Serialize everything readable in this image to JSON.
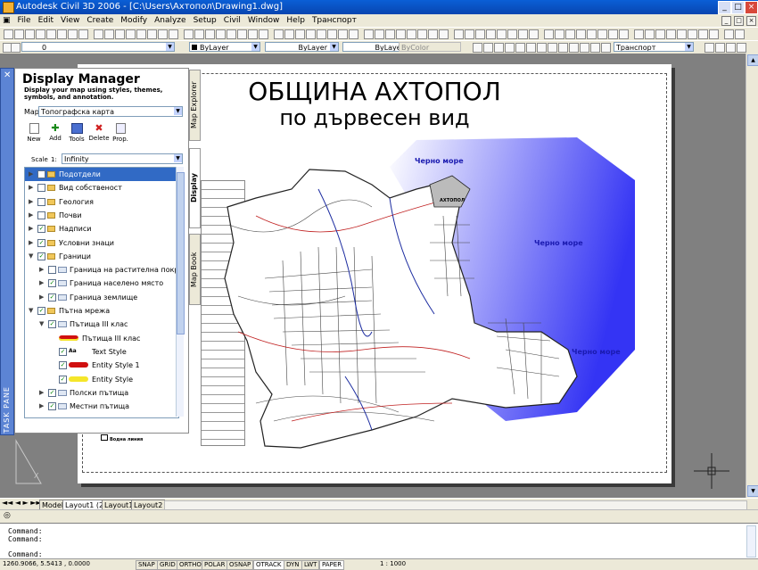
{
  "window": {
    "title": "Autodesk Civil 3D 2006 - [C:\\Users\\Ахтопол\\Drawing1.dwg]",
    "controls": [
      "_",
      "□",
      "×"
    ]
  },
  "menu": [
    "File",
    "Edit",
    "View",
    "Create",
    "Modify",
    "Analyze",
    "Setup",
    "Civil",
    "Window",
    "Help",
    "Транспорт"
  ],
  "toolbar2": {
    "layer_combo": "0",
    "color_combo": "ByLayer",
    "linetype_combo": "ByLayer",
    "lineweight_combo": "ByLayer",
    "plotstyle_combo": "ByColor",
    "named_combo": "Транспорт"
  },
  "task_pane": {
    "strip_label": "TASK PANE",
    "title": "Display Manager",
    "subtitle": "Display your map using styles, themes, symbols, and annotation.",
    "map_label": "Map",
    "map_value": "Топографска карта",
    "buttons": [
      "New",
      "Add",
      "Tools",
      "Delete",
      "Prop."
    ],
    "scale_label": "Scale",
    "scale_prefix": "1:",
    "scale_value": "Infinity",
    "side_tabs": [
      "Map Explorer",
      "Display",
      "Map Book"
    ],
    "tree": [
      {
        "label": "Подотдели",
        "indent": 0,
        "checked": false,
        "kind": "folder",
        "selected": true
      },
      {
        "label": "Вид собственост",
        "indent": 0,
        "checked": false,
        "kind": "folder"
      },
      {
        "label": "Геология",
        "indent": 0,
        "checked": false,
        "kind": "folder"
      },
      {
        "label": "Почви",
        "indent": 0,
        "checked": false,
        "kind": "folder"
      },
      {
        "label": "Надписи",
        "indent": 0,
        "checked": true,
        "kind": "folder"
      },
      {
        "label": "Условни знаци",
        "indent": 0,
        "checked": true,
        "kind": "folder"
      },
      {
        "label": "Граници",
        "indent": 0,
        "checked": true,
        "kind": "folder",
        "expanded": true
      },
      {
        "label": "Граница на растителна покривка",
        "indent": 1,
        "checked": false,
        "kind": "layer"
      },
      {
        "label": "Граница населено място",
        "indent": 1,
        "checked": true,
        "kind": "layer"
      },
      {
        "label": "Граница землище",
        "indent": 1,
        "checked": true,
        "kind": "layer"
      },
      {
        "label": "Пътна мрежа",
        "indent": 0,
        "checked": true,
        "kind": "folder",
        "expanded": true
      },
      {
        "label": "Пътища III клас",
        "indent": 1,
        "checked": true,
        "kind": "layer",
        "expanded": true
      },
      {
        "label": "Пътища III клас",
        "indent": 2,
        "checked": null,
        "kind": "swatch-red"
      },
      {
        "label": "Text Style",
        "indent": 2,
        "checked": true,
        "kind": "swatch-text"
      },
      {
        "label": "Entity Style 1",
        "indent": 2,
        "checked": true,
        "kind": "swatch-redline"
      },
      {
        "label": "Entity Style",
        "indent": 2,
        "checked": true,
        "kind": "swatch-yellow"
      },
      {
        "label": "Полски пътища",
        "indent": 1,
        "checked": true,
        "kind": "layer"
      },
      {
        "label": "Местни пътища",
        "indent": 1,
        "checked": true,
        "kind": "layer"
      }
    ]
  },
  "map": {
    "title_line1": "ОБЩИНА АХТОПОЛ",
    "title_line2": "по дървесен вид",
    "sea_labels": [
      "Черно море",
      "Черно море",
      "Черно море"
    ],
    "town_label": "АХТОПОЛ",
    "legend_entry": "Водна линия"
  },
  "layout_tabs": [
    "Model",
    "Layout1 (2)",
    "Layout1",
    "Layout2"
  ],
  "command_lines": [
    "Command:",
    "Command:",
    "",
    "Command:"
  ],
  "status": {
    "coords": "1260.9066,  5.5413  , 0.0000",
    "toggles": [
      "SNAP",
      "GRID",
      "ORTHO",
      "POLAR",
      "OSNAP",
      "OTRACK",
      "DYN",
      "LWT",
      "PAPER"
    ],
    "scale": "1 : 1000"
  },
  "colors": {
    "title_blue": "#0a5fd6",
    "sea_blue": "#3a3aff",
    "selection": "#316ac5",
    "road_red": "#d01010"
  }
}
